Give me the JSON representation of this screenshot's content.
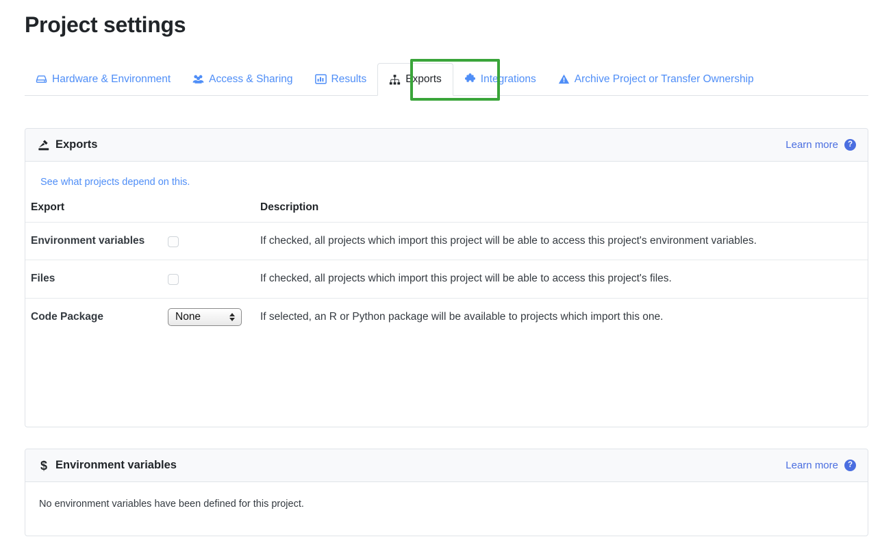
{
  "page": {
    "title": "Project settings"
  },
  "tabs": [
    {
      "label": "Hardware & Environment",
      "icon": "hard-drive-icon",
      "active": false
    },
    {
      "label": "Access & Sharing",
      "icon": "users-icon",
      "active": false
    },
    {
      "label": "Results",
      "icon": "bar-chart-icon",
      "active": false
    },
    {
      "label": "Exports",
      "icon": "sitemap-icon",
      "active": true
    },
    {
      "label": "Integrations",
      "icon": "puzzle-piece-icon",
      "active": false
    },
    {
      "label": "Archive Project or Transfer Ownership",
      "icon": "warning-triangle-icon",
      "active": false
    }
  ],
  "highlight": {
    "color": "#3aa53a",
    "target_tab": "Exports"
  },
  "colors": {
    "tab_link": "#4f8ef7",
    "learn_more_link": "#4a6ee0",
    "body_link": "#4f8ef7",
    "card_border": "#dfe3e8",
    "card_header_bg": "#f8f9fb",
    "highlight_green": "#3aa53a"
  },
  "exports_card": {
    "title": "Exports",
    "icon": "export-upload-icon",
    "learn_more": "Learn more",
    "help_icon": "question-circle-icon",
    "dependency_link": "See what projects depend on this.",
    "columns": [
      "Export",
      "Description"
    ],
    "rows": [
      {
        "name": "Environment variables",
        "control": "checkbox",
        "checked": false,
        "description": "If checked, all projects which import this project will be able to access this project's environment variables."
      },
      {
        "name": "Files",
        "control": "checkbox",
        "checked": false,
        "description": "If checked, all projects which import this project will be able to access this project's files."
      },
      {
        "name": "Code Package",
        "control": "select",
        "selected": "None",
        "options": [
          "None"
        ],
        "description": "If selected, an R or Python package will be available to projects which import this one."
      }
    ]
  },
  "env_card": {
    "title": "Environment variables",
    "icon": "dollar-sign-icon",
    "learn_more": "Learn more",
    "help_icon": "question-circle-icon",
    "empty_message": "No environment variables have been defined for this project."
  }
}
